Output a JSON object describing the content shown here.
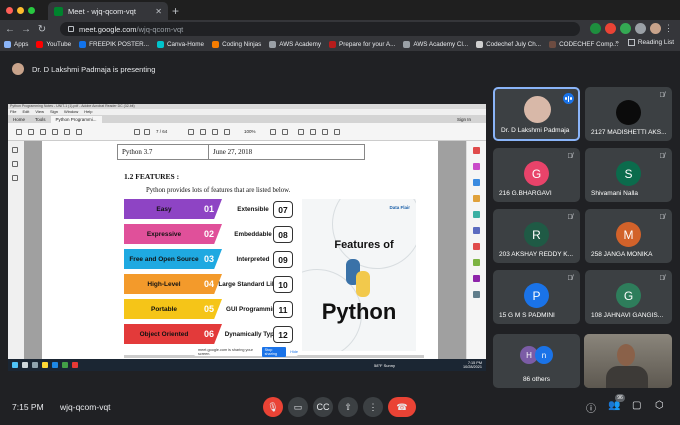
{
  "browser": {
    "tab_title": "Meet - wjq-qcom-vqt",
    "url_domain": "meet.google.com",
    "url_path": "/wjq-qcom-vqt",
    "bookmarks": [
      "Apps",
      "YouTube",
      "FREEPIK POSTER...",
      "Canva-Home",
      "Coding Ninjas",
      "AWS Academy",
      "Prepare for your A...",
      "AWS Academy Cl...",
      "Codechef July Ch...",
      "CODECHEF Comp..."
    ],
    "bookmark_more": "»",
    "reading_list": "Reading List"
  },
  "meet": {
    "presenting_text": "Dr. D Lakshmi Padmaja is presenting",
    "time": "7:15 PM",
    "code": "wjq-qcom-vqt",
    "participant_count": "96"
  },
  "acrobat": {
    "title_bar": "Python Programming Notes - UNIT-1 (1).pdf - Adobe Acrobat Reader DC (32-bit)",
    "menu": [
      "File",
      "Edit",
      "View",
      "Sign",
      "Window",
      "Help"
    ],
    "tabs": [
      "Home",
      "Tools",
      "Python Programmi..."
    ],
    "sign_in": "Sign In",
    "page_current": "7",
    "page_total": "/ 64",
    "zoom": "100%"
  },
  "document": {
    "version_cell": "Python 3.7",
    "date_cell": "June 27, 2018",
    "heading": "1.2 FEATURES :",
    "intro": "Python provides lots of features that are listed below.",
    "left_features": [
      {
        "label": "Easy",
        "num": "01",
        "color": "#8e44c4"
      },
      {
        "label": "Expressive",
        "num": "02",
        "color": "#e0509a"
      },
      {
        "label": "Free and Open Source",
        "num": "03",
        "color": "#1fa9e1"
      },
      {
        "label": "High-Level",
        "num": "04",
        "color": "#f39a2b"
      },
      {
        "label": "Portable",
        "num": "05",
        "color": "#f5c518"
      },
      {
        "label": "Object Oriented",
        "num": "06",
        "color": "#e33a3a"
      }
    ],
    "right_features": [
      {
        "label": "Extensible",
        "num": "07"
      },
      {
        "label": "Embeddable",
        "num": "08"
      },
      {
        "label": "Interpreted",
        "num": "09"
      },
      {
        "label": "Large Standard Library",
        "num": "10"
      },
      {
        "label": "GUI Programming",
        "num": "11"
      },
      {
        "label": "Dynamically Typed",
        "num": "12"
      }
    ],
    "art_title": "Features of",
    "art_big": "Python",
    "art_brand": "Data Flair"
  },
  "share_bar": {
    "text": "meet.google.com is sharing your screen.",
    "stop": "Stop sharing",
    "hide": "Hide"
  },
  "taskbar": {
    "weather": "58°F Sunny",
    "clock": "7:15 PM",
    "date": "10/28/2021"
  },
  "participants": [
    {
      "name": "Dr. D Lakshmi Padmaja",
      "initial": "",
      "color": "#d8b8a8",
      "active": true
    },
    {
      "name": "2127 MADISHETTI AKS...",
      "initial": "",
      "color": "#0b0b0b",
      "active": false
    },
    {
      "name": "216 G.BHARGAVI",
      "initial": "G",
      "color": "#e8436a",
      "active": false
    },
    {
      "name": "Shivamani Nalla",
      "initial": "S",
      "color": "#0b6b4c",
      "active": false
    },
    {
      "name": "203 AKSHAY REDDY K...",
      "initial": "R",
      "color": "#1f5a45",
      "active": false
    },
    {
      "name": "258 JANGA MONIKA",
      "initial": "M",
      "color": "#d2622a",
      "active": false
    },
    {
      "name": "15 G M S PADMINI",
      "initial": "P",
      "color": "#1a73e8",
      "active": false
    },
    {
      "name": "108 JAHNAVI GANGIS...",
      "initial": "G",
      "color": "#2e7d5b",
      "active": false
    }
  ],
  "others": {
    "label": "86 others",
    "a1": "H",
    "a2": "n",
    "c1": "#7b5ca6",
    "c2": "#1a73e8"
  }
}
